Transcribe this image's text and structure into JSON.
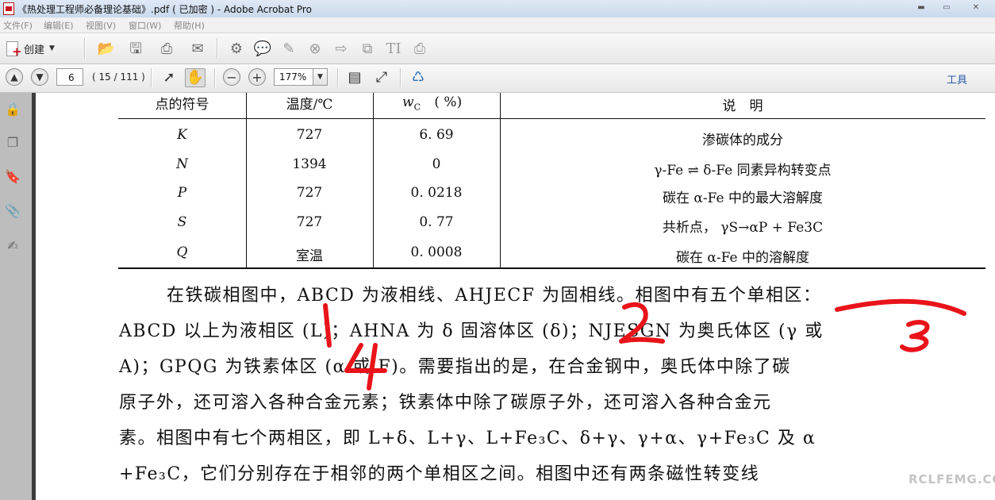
{
  "window": {
    "title": "《热处理工程师必备理论基础》.pdf ( 已加密 ) - Adobe Acrobat Pro",
    "controls": [
      "minimize",
      "maximize",
      "close"
    ]
  },
  "menu": {
    "items": [
      "文件(F)",
      "编辑(E)",
      "视图(V)",
      "窗口(W)",
      "帮助(H)"
    ]
  },
  "toolbar1": {
    "create_label": "创建",
    "icons": [
      "folder-open-icon",
      "save-icon",
      "print-icon",
      "email-icon",
      "gear-icon",
      "comment-icon",
      "sign-icon",
      "delete-icon",
      "export-icon",
      "combine-icon",
      "text-icon",
      "printer-alt-icon"
    ]
  },
  "toolbar2": {
    "page_current": "6",
    "page_count": "( 15 / 111 )",
    "zoom": "177%",
    "tools_label": "工具"
  },
  "table": {
    "headers": [
      "点的符号",
      "温度/℃",
      "w",
      "C",
      "( %)",
      "说　明"
    ],
    "rows": [
      {
        "symbol": "K",
        "temp": "727",
        "wc": "6. 69",
        "desc": "渗碳体的成分"
      },
      {
        "symbol": "N",
        "temp": "1394",
        "wc": "0",
        "desc": "γ-Fe ⇌ δ-Fe 同素异构转变点"
      },
      {
        "symbol": "P",
        "temp": "727",
        "wc": "0. 0218",
        "desc": "碳在 α-Fe 中的最大溶解度"
      },
      {
        "symbol": "S",
        "temp": "727",
        "wc": "0. 77",
        "desc": "共析点， γS→αP + Fe3C"
      },
      {
        "symbol": "Q",
        "temp": "室温",
        "wc": "0. 0008",
        "desc": "碳在 α-Fe 中的溶解度"
      }
    ]
  },
  "body_text": {
    "line1": "在铁碳相图中，ABCD 为液相线、AHJECF 为固相线。相图中有五个单相区：",
    "line2": "ABCD 以上为液相区 (L)；AHNA 为 δ 固溶体区 (δ)；NJESGN 为奥氏体区 (γ 或",
    "line3": "A)；GPQG 为铁素体区 (α 或 F)。需要指出的是，在合金钢中，奥氏体中除了碳",
    "line4": "原子外，还可溶入各种合金元素；铁素体中除了碳原子外，还可溶入各种合金元",
    "line5": "素。相图中有七个两相区，即 L+δ、L+γ、L+Fe₃C、δ+γ、γ+α、γ+Fe₃C 及 α",
    "line6": "+Fe₃C，它们分别存在于相邻的两个单相区之间。相图中还有两条磁性转变线",
    "line7": "……"
  },
  "annotations": {
    "numbers": [
      "1",
      "2",
      "3",
      "4"
    ],
    "color": "#e8141a"
  },
  "watermark": "RCLFEMG.COM",
  "colors": {
    "accent": "#2a5da8",
    "nav_panel": "#bdbdbd",
    "handwriting": "#e8141a"
  }
}
